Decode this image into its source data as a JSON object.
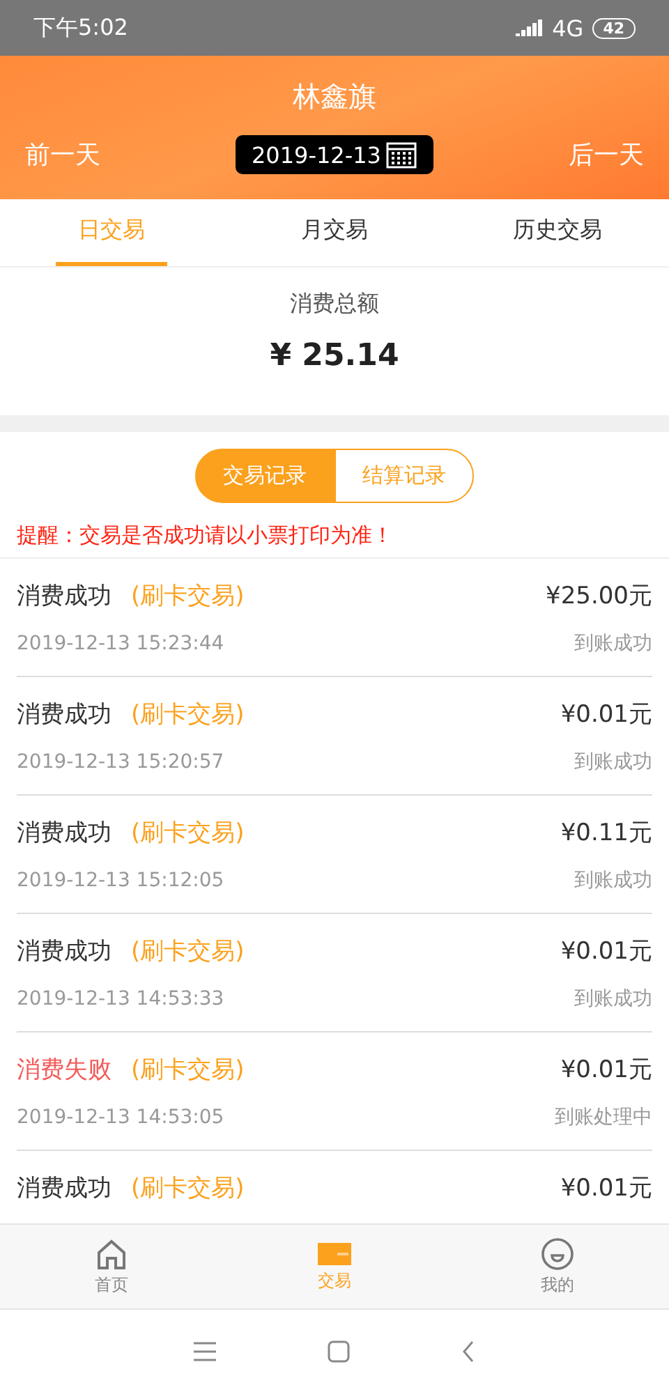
{
  "status_bar": {
    "time": "下午5:02",
    "network": "4G",
    "battery": "42"
  },
  "header": {
    "title": "林鑫旗",
    "prev": "前一天",
    "date": "2019-12-13",
    "next": "后一天"
  },
  "tabs": [
    {
      "label": "日交易",
      "selected": true
    },
    {
      "label": "月交易",
      "selected": false
    },
    {
      "label": "历史交易",
      "selected": false
    }
  ],
  "summary": {
    "label": "消费总额",
    "amount": "¥ 25.14"
  },
  "segments": [
    {
      "label": "交易记录",
      "selected": true
    },
    {
      "label": "结算记录",
      "selected": false
    }
  ],
  "notice": "提醒：交易是否成功请以小票打印为准！",
  "records": [
    {
      "status": "消费成功",
      "failed": false,
      "type": "(刷卡交易)",
      "amount": "¥25.00元",
      "time": "2019-12-13 15:23:44",
      "result": "到账成功"
    },
    {
      "status": "消费成功",
      "failed": false,
      "type": "(刷卡交易)",
      "amount": "¥0.01元",
      "time": "2019-12-13 15:20:57",
      "result": "到账成功"
    },
    {
      "status": "消费成功",
      "failed": false,
      "type": "(刷卡交易)",
      "amount": "¥0.11元",
      "time": "2019-12-13 15:12:05",
      "result": "到账成功"
    },
    {
      "status": "消费成功",
      "failed": false,
      "type": "(刷卡交易)",
      "amount": "¥0.01元",
      "time": "2019-12-13 14:53:33",
      "result": "到账成功"
    },
    {
      "status": "消费失败",
      "failed": true,
      "type": "(刷卡交易)",
      "amount": "¥0.01元",
      "time": "2019-12-13 14:53:05",
      "result": "到账处理中"
    },
    {
      "status": "消费成功",
      "failed": false,
      "type": "(刷卡交易)",
      "amount": "¥0.01元"
    }
  ],
  "bottom_nav": [
    {
      "label": "首页",
      "kind": "home",
      "selected": false
    },
    {
      "label": "交易",
      "kind": "card",
      "selected": true
    },
    {
      "label": "我的",
      "kind": "face",
      "selected": false
    }
  ]
}
